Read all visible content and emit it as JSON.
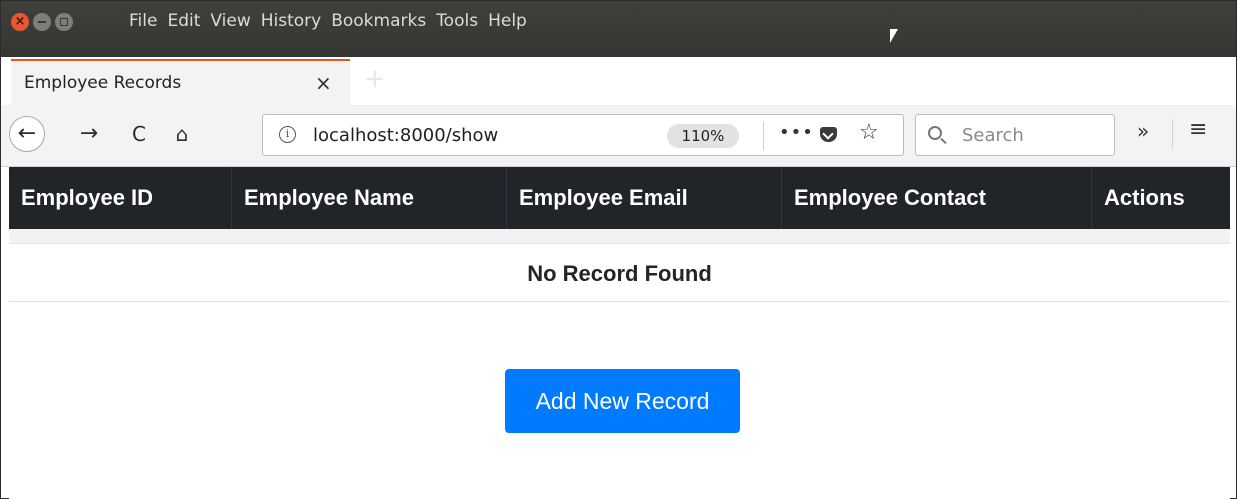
{
  "window": {
    "close_glyph": "×",
    "controls": [
      "close-button",
      "minimize-button",
      "maximize-button"
    ]
  },
  "menu": [
    "File",
    "Edit",
    "View",
    "History",
    "Bookmarks",
    "Tools",
    "Help"
  ],
  "tab": {
    "title": "Employee Records",
    "close_glyph": "×",
    "new_tab_glyph": "+",
    "accent_color": "#e95420"
  },
  "toolbar": {
    "back_glyph": "←",
    "forward_glyph": "→",
    "reload_glyph": "C",
    "home_glyph": "⌂",
    "info_glyph": "i",
    "url": "localhost:8000/show",
    "zoom": "110%",
    "more_glyph": "•••",
    "star_glyph": "☆",
    "search_placeholder": "Search",
    "overflow_glyph": "»",
    "menu_glyph": "≡"
  },
  "table": {
    "headers": [
      "Employee ID",
      "Employee Name",
      "Employee Email",
      "Employee Contact",
      "Actions"
    ],
    "header_bg": "#212529",
    "empty_message": "No Record Found"
  },
  "add_button": {
    "label": "Add New Record",
    "color": "#007bff"
  }
}
